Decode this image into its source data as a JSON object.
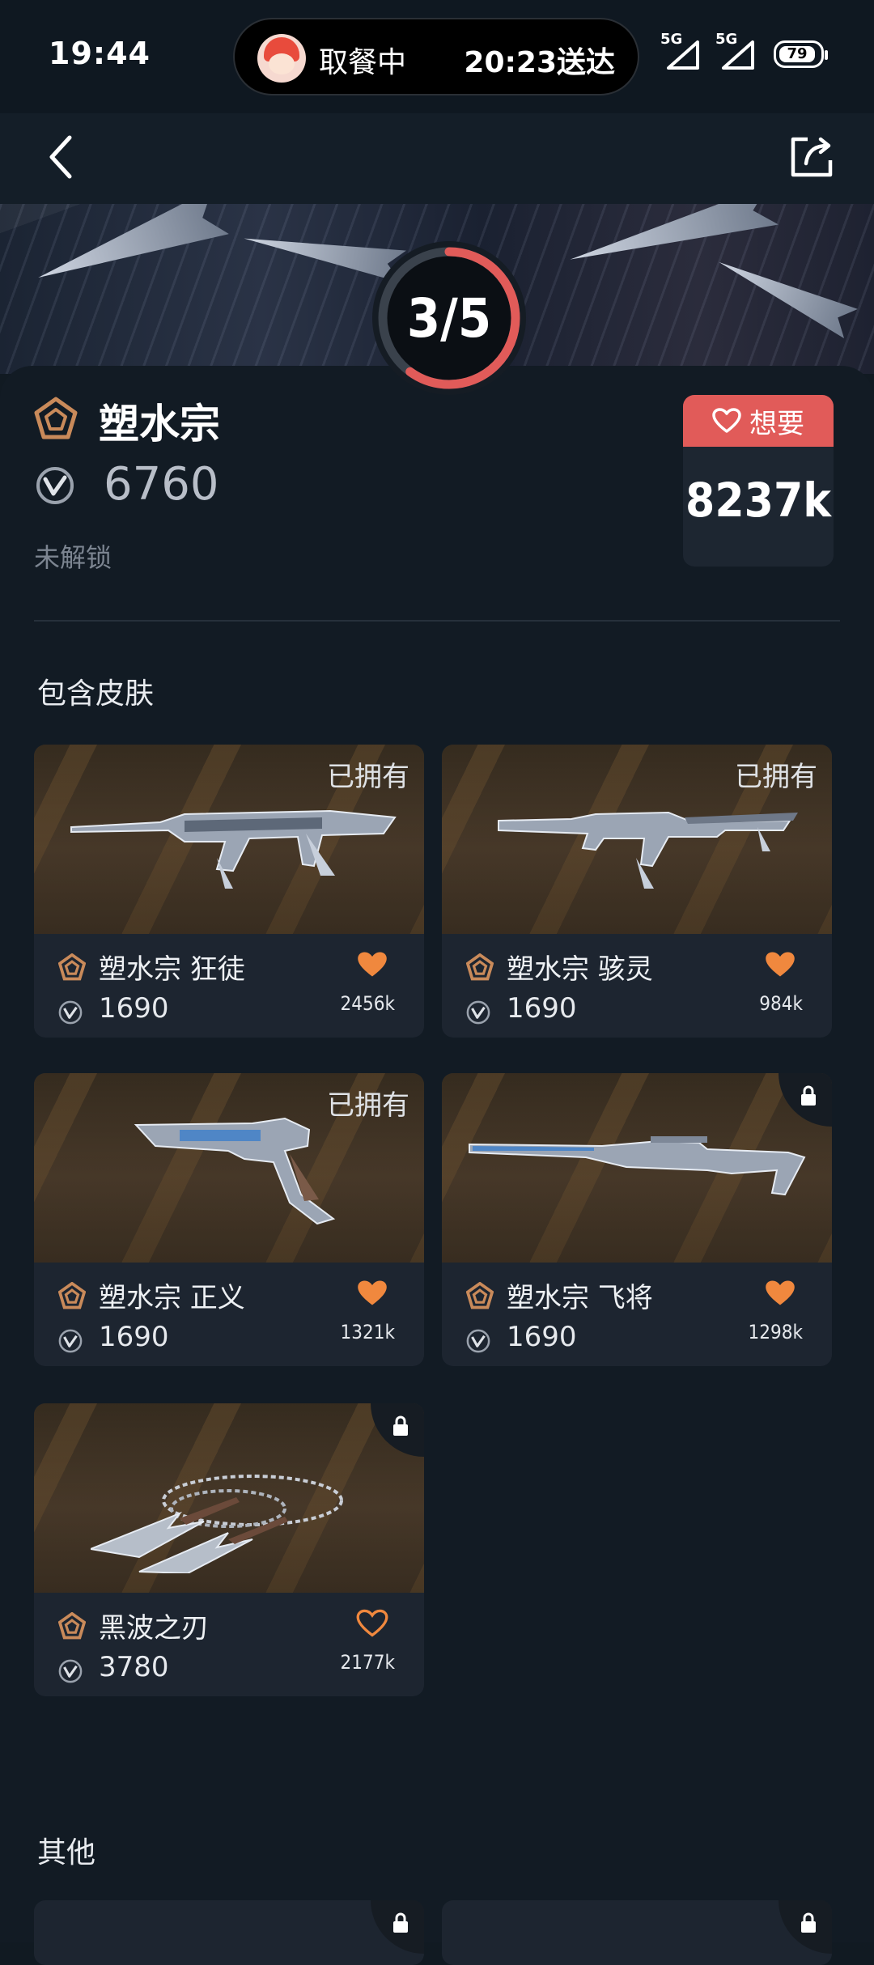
{
  "status_bar": {
    "time": "19:44",
    "delivery_status": "取餐中",
    "delivery_eta": "20:23送达",
    "signal_1": "5G",
    "signal_2": "5G",
    "battery": "79"
  },
  "nav": {
    "back_icon": "back-icon",
    "share_icon": "share-icon"
  },
  "progress": {
    "label": "3/5",
    "owned": 3,
    "total": 5
  },
  "bundle": {
    "name": "塑水宗",
    "price": "6760",
    "unlock_status": "未解锁",
    "want_label": "想要",
    "want_count": "8237k"
  },
  "sections": {
    "skins_title": "包含皮肤",
    "other_title": "其他"
  },
  "skins": [
    {
      "name": "塑水宗 狂徒",
      "price": "1690",
      "likes": "2456k",
      "owned_label": "已拥有",
      "liked": true
    },
    {
      "name": "塑水宗 骇灵",
      "price": "1690",
      "likes": "984k",
      "owned_label": "已拥有",
      "liked": true
    },
    {
      "name": "塑水宗 正义",
      "price": "1690",
      "likes": "1321k",
      "owned_label": "已拥有",
      "liked": true
    },
    {
      "name": "塑水宗 飞将",
      "price": "1690",
      "likes": "1298k",
      "owned_label": "",
      "liked": true
    },
    {
      "name": "黑波之刃",
      "price": "3780",
      "likes": "2177k",
      "owned_label": "",
      "liked": false
    }
  ],
  "colors": {
    "background": "#111a22",
    "card": "#1d2530",
    "accent_red": "#e15b59",
    "heart_orange": "#f0883e",
    "rank_bronze": "#c98a5a"
  }
}
